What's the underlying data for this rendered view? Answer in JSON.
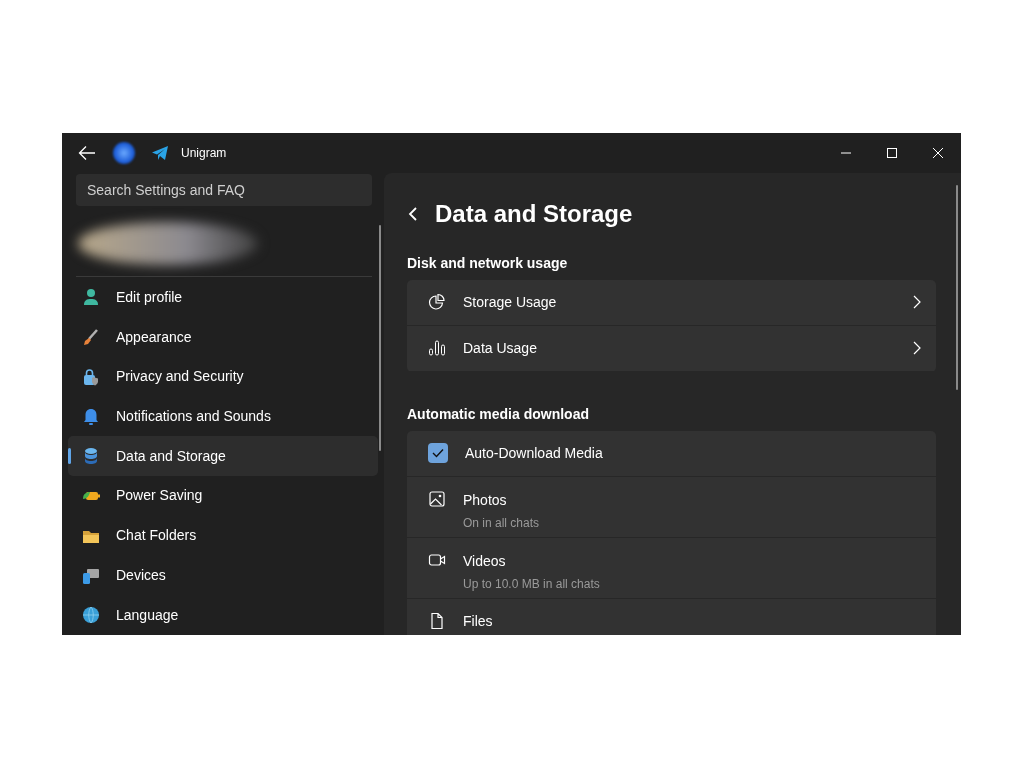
{
  "window": {
    "title": "Unigram"
  },
  "search": {
    "placeholder": "Search Settings and FAQ"
  },
  "sidebar": {
    "items": [
      {
        "label": "Edit profile",
        "selected": false
      },
      {
        "label": "Appearance",
        "selected": false
      },
      {
        "label": "Privacy and Security",
        "selected": false
      },
      {
        "label": "Notifications and Sounds",
        "selected": false
      },
      {
        "label": "Data and Storage",
        "selected": true
      },
      {
        "label": "Power Saving",
        "selected": false
      },
      {
        "label": "Chat Folders",
        "selected": false
      },
      {
        "label": "Devices",
        "selected": false
      },
      {
        "label": "Language",
        "selected": false
      }
    ]
  },
  "page": {
    "title": "Data and Storage",
    "sections": [
      {
        "header": "Disk and network usage",
        "rows": [
          {
            "kind": "link",
            "label": "Storage Usage"
          },
          {
            "kind": "link",
            "label": "Data Usage"
          }
        ]
      },
      {
        "header": "Automatic media download",
        "rows": [
          {
            "kind": "checkbox",
            "label": "Auto-Download Media",
            "checked": true
          },
          {
            "kind": "option",
            "label": "Photos",
            "subtitle": "On in all chats"
          },
          {
            "kind": "option",
            "label": "Videos",
            "subtitle": "Up to 10.0 MB in all chats"
          },
          {
            "kind": "option",
            "label": "Files"
          }
        ]
      }
    ]
  }
}
